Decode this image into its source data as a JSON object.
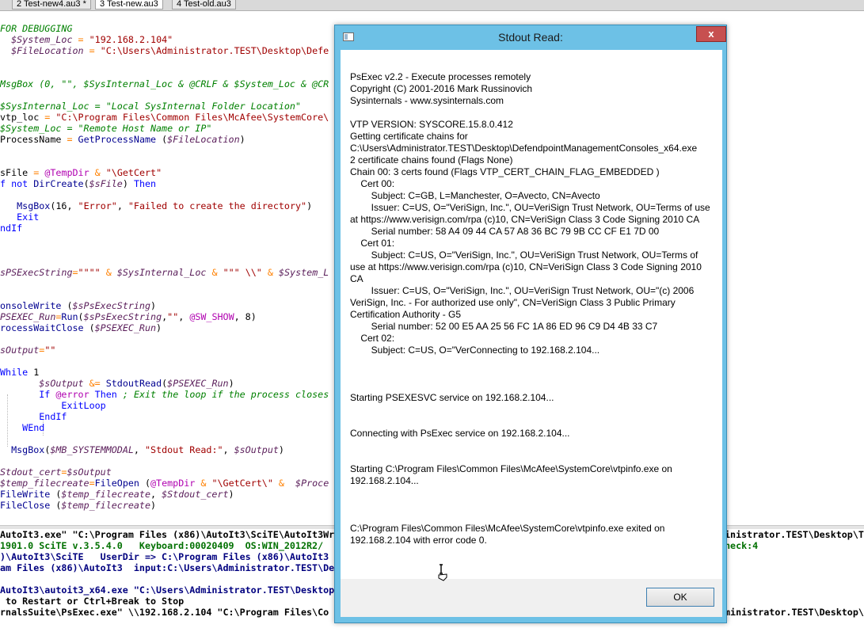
{
  "tabs": [
    {
      "label": "2 Test-new4.au3 *"
    },
    {
      "label": "3 Test-new.au3"
    },
    {
      "label": "4 Test-old.au3"
    }
  ],
  "editor": {
    "lines": [
      [
        [
          "c",
          "FOR DEBUGGING"
        ]
      ],
      [
        [
          "p",
          "  "
        ],
        [
          "v",
          "$System_Loc"
        ],
        [
          "p",
          " "
        ],
        [
          "o",
          "="
        ],
        [
          "p",
          " "
        ],
        [
          "s",
          "\"192.168.2.104\""
        ]
      ],
      [
        [
          "p",
          "  "
        ],
        [
          "v",
          "$FileLocation"
        ],
        [
          "p",
          " "
        ],
        [
          "o",
          "="
        ],
        [
          "p",
          " "
        ],
        [
          "s",
          "\"C:\\Users\\Administrator.TEST\\Desktop\\Defe"
        ]
      ],
      [],
      [],
      [
        [
          "c",
          "MsgBox (0, \"\", $SysInternal_Loc & @CRLF & $System_Loc & @CR"
        ]
      ],
      [],
      [
        [
          "c",
          "$SysInternal_Loc = \"Local SysInternal Folder Location\""
        ]
      ],
      [
        [
          "p",
          "vtp_loc "
        ],
        [
          "o",
          "="
        ],
        [
          "p",
          " "
        ],
        [
          "s",
          "\"C:\\Program Files\\Common Files\\McAfee\\SystemCore\\"
        ]
      ],
      [
        [
          "c",
          "$System_Loc = \"Remote Host Name or IP\""
        ]
      ],
      [
        [
          "p",
          "ProcessName "
        ],
        [
          "o",
          "="
        ],
        [
          "p",
          " "
        ],
        [
          "f",
          "GetProcessName"
        ],
        [
          "p",
          " ("
        ],
        [
          "v",
          "$FileLocation"
        ],
        [
          "p",
          ")"
        ]
      ],
      [],
      [],
      [
        [
          "p",
          "sFile "
        ],
        [
          "o",
          "="
        ],
        [
          "p",
          " "
        ],
        [
          "m",
          "@TempDir"
        ],
        [
          "p",
          " "
        ],
        [
          "o",
          "&"
        ],
        [
          "p",
          " "
        ],
        [
          "s",
          "\"\\GetCert\""
        ]
      ],
      [
        [
          "k",
          "f not "
        ],
        [
          "f",
          "DirCreate"
        ],
        [
          "p",
          "("
        ],
        [
          "v",
          "$sFile"
        ],
        [
          "p",
          ") "
        ],
        [
          "k",
          "Then"
        ]
      ],
      [],
      [
        [
          "p",
          "   "
        ],
        [
          "f",
          "MsgBox"
        ],
        [
          "p",
          "(16, "
        ],
        [
          "s",
          "\"Error\""
        ],
        [
          "p",
          ", "
        ],
        [
          "s",
          "\"Failed to create the directory\""
        ],
        [
          "p",
          ")"
        ]
      ],
      [
        [
          "p",
          "   "
        ],
        [
          "k",
          "Exit"
        ]
      ],
      [
        [
          "k",
          "ndIf"
        ]
      ],
      [],
      [],
      [],
      [
        [
          "v",
          "sPSExecString"
        ],
        [
          "o",
          "="
        ],
        [
          "s",
          "\"\"\"\""
        ],
        [
          "p",
          " "
        ],
        [
          "o",
          "&"
        ],
        [
          "p",
          " "
        ],
        [
          "v",
          "$SysInternal_Loc"
        ],
        [
          "p",
          " "
        ],
        [
          "o",
          "&"
        ],
        [
          "p",
          " "
        ],
        [
          "s",
          "\"\"\" \\\\\""
        ],
        [
          "p",
          " "
        ],
        [
          "o",
          "&"
        ],
        [
          "p",
          " "
        ],
        [
          "v",
          "$System_L"
        ]
      ],
      [],
      [],
      [
        [
          "f",
          "onsoleWrite"
        ],
        [
          "p",
          " ("
        ],
        [
          "v",
          "$sPsExecString"
        ],
        [
          "p",
          ")"
        ]
      ],
      [
        [
          "v",
          "PSEXEC_Run"
        ],
        [
          "o",
          "="
        ],
        [
          "f",
          "Run"
        ],
        [
          "p",
          "("
        ],
        [
          "v",
          "$sPsExecString"
        ],
        [
          "p",
          ","
        ],
        [
          "s",
          "\"\""
        ],
        [
          "p",
          ", "
        ],
        [
          "m",
          "@SW_SHOW"
        ],
        [
          "p",
          ", 8)"
        ]
      ],
      [
        [
          "f",
          "rocessWaitClose"
        ],
        [
          "p",
          " ("
        ],
        [
          "v",
          "$PSEXEC_Run"
        ],
        [
          "p",
          ")"
        ]
      ],
      [],
      [
        [
          "v",
          "sOutput"
        ],
        [
          "o",
          "="
        ],
        [
          "s",
          "\"\""
        ]
      ],
      [],
      [
        [
          "k",
          "While"
        ],
        [
          "p",
          " 1"
        ]
      ],
      [
        [
          "p",
          "       "
        ],
        [
          "v",
          "$sOutput"
        ],
        [
          "p",
          " "
        ],
        [
          "o",
          "&="
        ],
        [
          "p",
          " "
        ],
        [
          "f",
          "StdoutRead"
        ],
        [
          "p",
          "("
        ],
        [
          "v",
          "$PSEXEC_Run"
        ],
        [
          "p",
          ")"
        ]
      ],
      [
        [
          "p",
          "       "
        ],
        [
          "k",
          "If"
        ],
        [
          "p",
          " "
        ],
        [
          "m",
          "@error"
        ],
        [
          "p",
          " "
        ],
        [
          "k",
          "Then"
        ],
        [
          "p",
          " "
        ],
        [
          "c",
          "; Exit the loop if the process closes"
        ]
      ],
      [
        [
          "p",
          "           "
        ],
        [
          "k",
          "ExitLoop"
        ]
      ],
      [
        [
          "p",
          "       "
        ],
        [
          "k",
          "EndIf"
        ]
      ],
      [
        [
          "p",
          "    "
        ],
        [
          "k",
          "WEnd"
        ]
      ],
      [],
      [
        [
          "p",
          "  "
        ],
        [
          "f",
          "MsgBox"
        ],
        [
          "p",
          "("
        ],
        [
          "v",
          "$MB_SYSTEMMODAL"
        ],
        [
          "p",
          ", "
        ],
        [
          "s",
          "\"Stdout Read:\""
        ],
        [
          "p",
          ", "
        ],
        [
          "v",
          "$sOutput"
        ],
        [
          "p",
          ")"
        ]
      ],
      [],
      [
        [
          "v",
          "Stdout_cert"
        ],
        [
          "o",
          "="
        ],
        [
          "v",
          "$sOutput"
        ]
      ],
      [
        [
          "v",
          "$temp_filecreate"
        ],
        [
          "o",
          "="
        ],
        [
          "f",
          "FileOpen"
        ],
        [
          "p",
          " ("
        ],
        [
          "m",
          "@TempDir"
        ],
        [
          "p",
          " "
        ],
        [
          "o",
          "&"
        ],
        [
          "p",
          " "
        ],
        [
          "s",
          "\"\\GetCert\\\""
        ],
        [
          "p",
          " "
        ],
        [
          "o",
          "&"
        ],
        [
          "p",
          "  "
        ],
        [
          "v",
          "$Proce"
        ]
      ],
      [
        [
          "f",
          "FileWrite"
        ],
        [
          "p",
          " ("
        ],
        [
          "v",
          "$temp_filecreate"
        ],
        [
          "p",
          ", "
        ],
        [
          "v",
          "$Stdout_cert"
        ],
        [
          "p",
          ")"
        ]
      ],
      [
        [
          "f",
          "FileClose"
        ],
        [
          "p",
          " ("
        ],
        [
          "v",
          "$temp_filecreate"
        ],
        [
          "p",
          ")"
        ]
      ]
    ]
  },
  "output": {
    "lines": [
      {
        "left": "AutoIt3.exe\" \"C:\\Program Files (x86)\\AutoIt3\\SciTE\\AutoIt3Wra",
        "right": "inistrator.TEST\\Desktop\\Te",
        "color": "blk"
      },
      {
        "left": "1901.0 SciTE v.3.5.4.0   Keyboard:00020409  OS:WIN_2012R2/",
        "right": "heck:4",
        "color": "grn"
      },
      {
        "left": ")\\AutoIt3\\SciTE   UserDir => C:\\Program Files (x86)\\AutoIt3",
        "right": "",
        "color": "blu"
      },
      {
        "left": "am Files (x86)\\AutoIt3  input:C:\\Users\\Administrator.TEST\\De",
        "right": "",
        "color": "blu"
      },
      {
        "left": "",
        "right": "",
        "color": "blk"
      },
      {
        "left": "AutoIt3\\autoit3_x64.exe \"C:\\Users\\Administrator.TEST\\Desktop",
        "right": "",
        "color": "blu"
      },
      {
        "left": " to Restart or Ctrl+Break to Stop",
        "right": "",
        "color": "blk"
      },
      {
        "left": "rnalsSuite\\PsExec.exe\" \\\\192.168.2.104 \"C:\\Program Files\\Co",
        "right": "ministrator.TEST\\Desktop\\",
        "color": "blk"
      }
    ]
  },
  "dialog": {
    "title": "Stdout Read:",
    "close_label": "x",
    "ok_label": "OK",
    "message": [
      "",
      "PsExec v2.2 - Execute processes remotely",
      "Copyright (C) 2001-2016 Mark Russinovich",
      "Sysinternals - www.sysinternals.com",
      "",
      "VTP VERSION: SYSCORE.15.8.0.412",
      "Getting certificate chains for",
      "C:\\Users\\Administrator.TEST\\Desktop\\DefendpointManagementConsoles_x64.exe",
      "2 certificate chains found (Flags None)",
      "Chain 00: 3 certs found (Flags VTP_CERT_CHAIN_FLAG_EMBEDDED )",
      "    Cert 00:",
      "        Subject: C=GB, L=Manchester, O=Avecto, CN=Avecto",
      "        Issuer: C=US, O=\"VeriSign, Inc.\", OU=VeriSign Trust Network, OU=Terms of use at https://www.verisign.com/rpa (c)10, CN=VeriSign Class 3 Code Signing 2010 CA",
      "        Serial number: 58 A4 09 44 CA 57 A8 36 BC 79 9B CC CF E1 7D 00",
      "    Cert 01:",
      "        Subject: C=US, O=\"VeriSign, Inc.\", OU=VeriSign Trust Network, OU=Terms of use at https://www.verisign.com/rpa (c)10, CN=VeriSign Class 3 Code Signing 2010 CA",
      "        Issuer: C=US, O=\"VeriSign, Inc.\", OU=VeriSign Trust Network, OU=\"(c) 2006 VeriSign, Inc. - For authorized use only\", CN=VeriSign Class 3 Public Primary Certification Authority - G5",
      "        Serial number: 52 00 E5 AA 25 56 FC 1A 86 ED 96 C9 D4 4B 33 C7",
      "    Cert 02:",
      "        Subject: C=US, O=\"VerConnecting to 192.168.2.104...",
      "",
      "",
      "",
      "Starting PSEXESVC service on 192.168.2.104...",
      "",
      "",
      "Connecting with PsExec service on 192.168.2.104...",
      "",
      "",
      "Starting C:\\Program Files\\Common Files\\McAfee\\SystemCore\\vtpinfo.exe on 192.168.2.104...",
      "",
      "",
      "",
      "C:\\Program Files\\Common Files\\McAfee\\SystemCore\\vtpinfo.exe exited on 192.168.2.104 with error code 0."
    ]
  }
}
